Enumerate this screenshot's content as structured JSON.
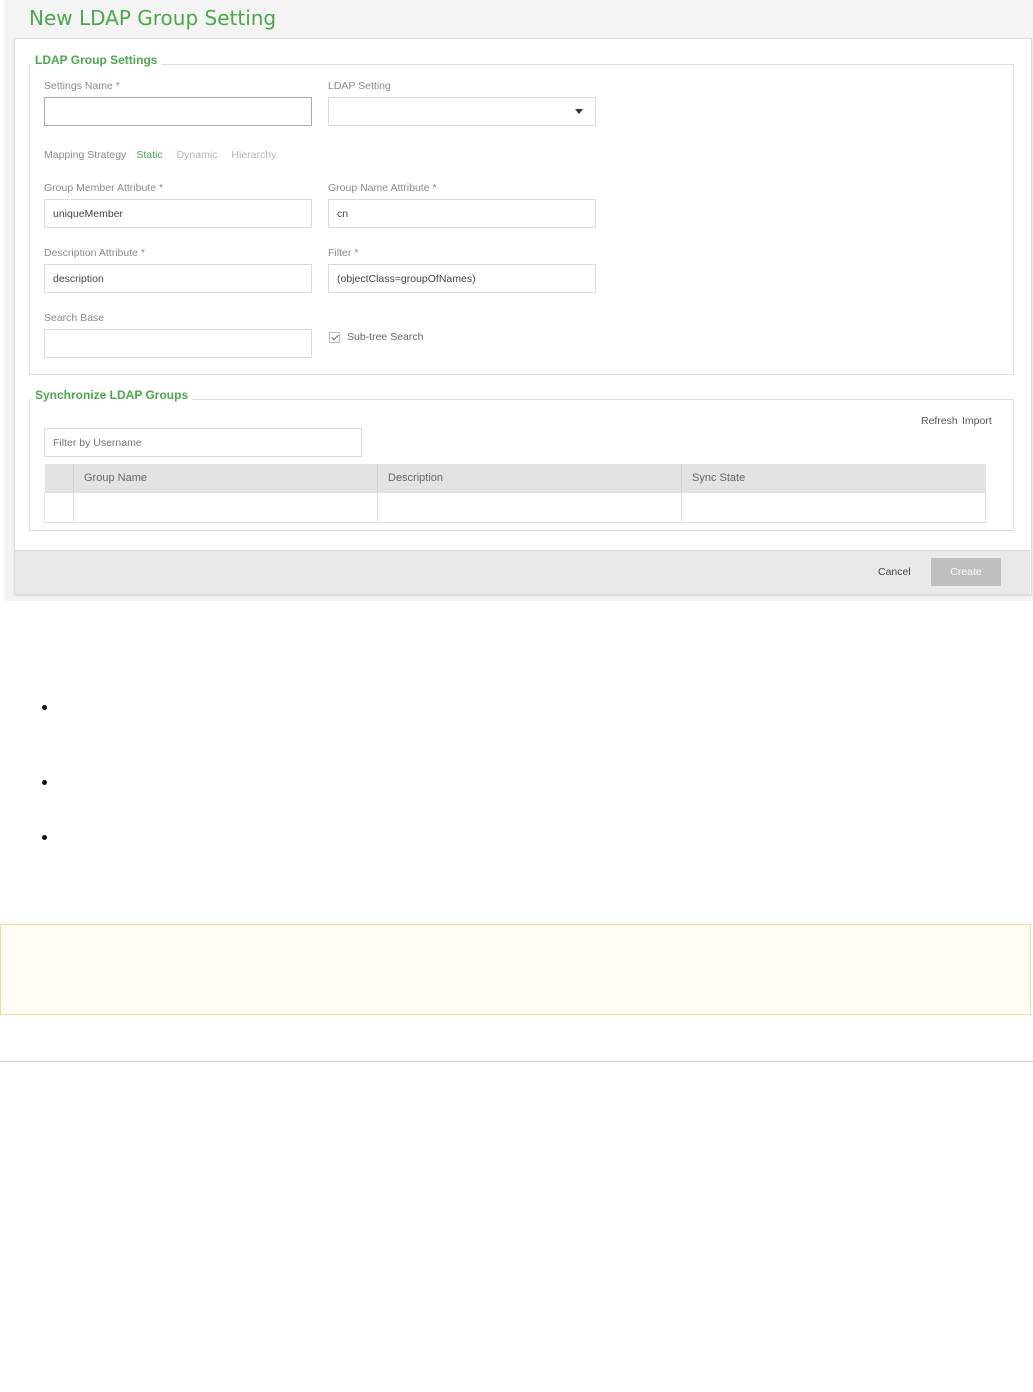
{
  "dialog": {
    "title": "New LDAP Group Setting"
  },
  "ldap_group_settings": {
    "legend": "LDAP Group Settings",
    "settings_name": {
      "label": "Settings Name *",
      "value": ""
    },
    "ldap_setting": {
      "label": "LDAP Setting",
      "value": ""
    },
    "mapping_strategy": {
      "label": "Mapping Strategy",
      "options": [
        "Static",
        "Dynamic",
        "Hierarchy"
      ],
      "selected": "Static"
    },
    "group_member_attribute": {
      "label": "Group Member Attribute *",
      "value": "uniqueMember"
    },
    "group_name_attribute": {
      "label": "Group Name Attribute *",
      "value": "cn"
    },
    "description_attribute": {
      "label": "Description Attribute *",
      "value": "description"
    },
    "filter": {
      "label": "Filter *",
      "value": "(objectClass=groupOfNames)"
    },
    "search_base": {
      "label": "Search Base",
      "value": ""
    },
    "subtree_search": {
      "label": "Sub-tree Search",
      "checked": true
    }
  },
  "sync_ldap_groups": {
    "legend": "Synchronize LDAP Groups",
    "refresh_label": "Refresh",
    "import_label": "Import",
    "filter_placeholder": "Filter by Username",
    "columns": [
      "Group Name",
      "Description",
      "Sync State"
    ]
  },
  "footer": {
    "cancel_label": "Cancel",
    "create_label": "Create"
  }
}
